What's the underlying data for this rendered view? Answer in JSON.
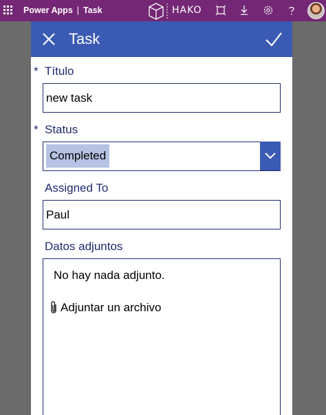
{
  "appbar": {
    "app_name": "Power Apps",
    "separator": "|",
    "screen_name": "Task",
    "logo_text": "HAKO",
    "icons": [
      "waffle-icon",
      "fit-screen-icon",
      "download-icon",
      "settings-icon",
      "help-icon"
    ],
    "color": "#742774"
  },
  "form": {
    "header": {
      "title": "Task",
      "color": "#3a5ab3"
    },
    "fields": {
      "titulo": {
        "label": "Título",
        "required_mark": "*",
        "value": "new task"
      },
      "status": {
        "label": "Status",
        "required_mark": "*",
        "value": "Completed"
      },
      "assigned_to": {
        "label": "Assigned To",
        "value": "Paul"
      },
      "attachments": {
        "label": "Datos adjuntos",
        "empty_text": "No hay nada adjunto.",
        "attach_link": "Adjuntar un archivo"
      }
    },
    "label_color": "#1e2a6e",
    "selected_highlight": "#b5c2e3"
  }
}
